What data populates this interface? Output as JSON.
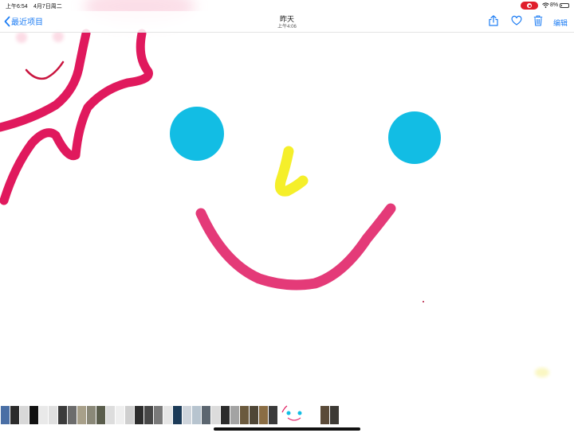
{
  "status_bar": {
    "time": "上午6:54",
    "date": "4月7日周二",
    "battery": "8%",
    "recording_color": "#e01e2b"
  },
  "nav": {
    "back_label": "最近项目",
    "title": "昨天",
    "subtitle": "上午4:06",
    "edit_label": "编辑",
    "icons": [
      "chevron-left-icon",
      "share-icon",
      "heart-icon",
      "trash-icon"
    ],
    "accent_color": "#1f7ef4"
  },
  "photo": {
    "description_colors": {
      "pink_stroke": "#e43a78",
      "blue_circle": "#12bde4",
      "yellow_stroke": "#f5ef2a"
    }
  },
  "thumbnails": {
    "colors": [
      "#4a6fa5",
      "#2b2b2b",
      "#d8d8d8",
      "#111111",
      "#e9e9e9",
      "#e0e0e0",
      "#3b3b3b",
      "#6c6c6c",
      "#a8a08a",
      "#8a8878",
      "#5a5d4c",
      "#dddddd",
      "#efefef",
      "#cfcfcf",
      "#2d2d2d",
      "#474747",
      "#7a7a7a",
      "#e6e6e6",
      "#1c3b58",
      "#cfd5dc",
      "#b7c4cf",
      "#5c6670",
      "#dcdcdc",
      "#2c2c2c",
      "#a3a3a3",
      "#6b5a3e",
      "#4f4636",
      "#8a6d44",
      "#3a3a3a",
      "#ffffff",
      "#ffffff",
      "#5a4a38",
      "#3d3a35"
    ],
    "current_index": 29
  }
}
